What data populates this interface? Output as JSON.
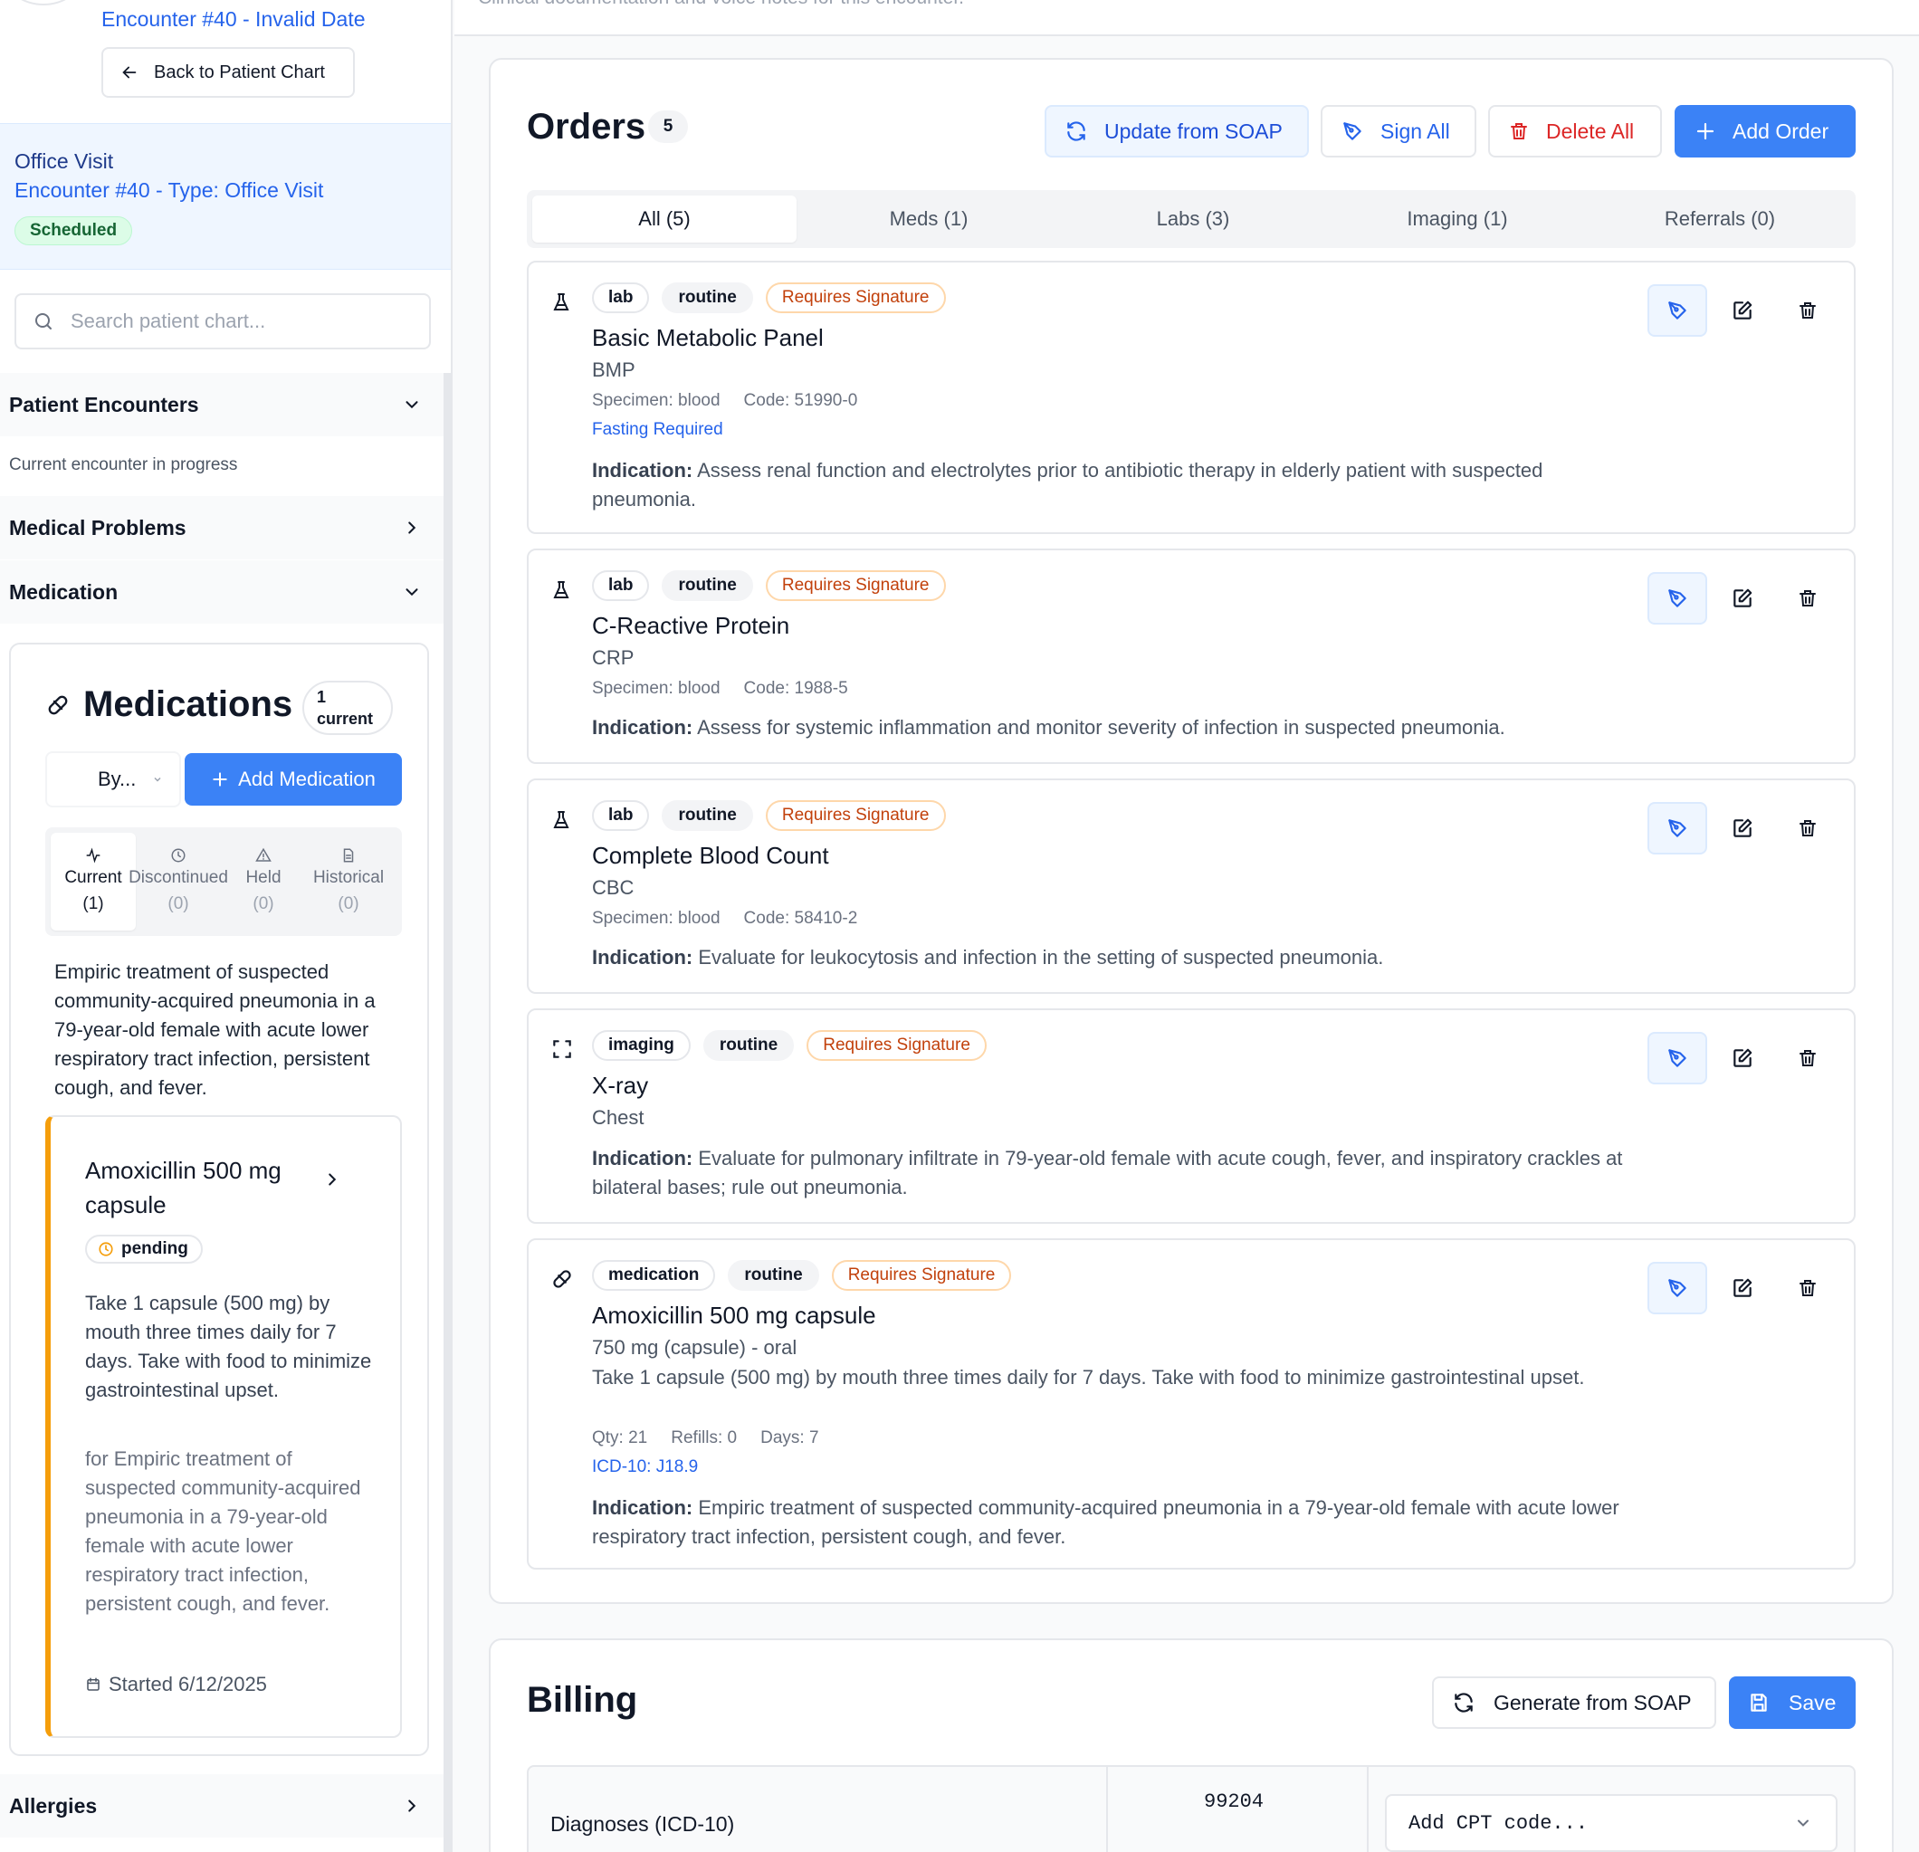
{
  "header": {
    "encounter_line": "Encounter #40 - Invalid Date",
    "back_button": "Back to Patient Chart",
    "subtitle": "Clinical documentation and voice notes for this encounter."
  },
  "visit": {
    "title": "Office Visit",
    "subtitle": "Encounter #40 - Type: Office Visit",
    "status": "Scheduled"
  },
  "search": {
    "placeholder": "Search patient chart..."
  },
  "sections": {
    "encounters": "Patient Encounters",
    "encounters_note": "Current encounter in progress",
    "problems": "Medical Problems",
    "medication": "Medication",
    "allergies": "Allergies"
  },
  "medications": {
    "title": "Medications",
    "count_num": "1",
    "count_label": "current",
    "sort_label": "By...",
    "add_button": "Add Medication",
    "tabs": [
      {
        "label": "Current",
        "count": "(1)",
        "icon": "activity-icon"
      },
      {
        "label": "Discontinued",
        "count": "(0)",
        "icon": "clock-icon"
      },
      {
        "label": "Held",
        "count": "(0)",
        "icon": "warning-icon"
      },
      {
        "label": "Historical",
        "count": "(0)",
        "icon": "document-icon"
      }
    ],
    "description": "Empiric treatment of suspected community-acquired pneumonia in a 79-year-old female with acute lower respiratory tract infection, persistent cough, and fever.",
    "item": {
      "name": "Amoxicillin 500 mg capsule",
      "status": "pending",
      "sig": "Take 1 capsule (500 mg) by mouth three times daily for 7 days. Take with food to minimize gastrointestinal upset.",
      "reason": "for Empiric treatment of suspected community-acquired pneumonia in a 79-year-old female with acute lower respiratory tract infection, persistent cough, and fever.",
      "started": "Started 6/12/2025",
      "accent_color": "#f59e0b"
    }
  },
  "orders": {
    "title": "Orders",
    "count": "5",
    "buttons": {
      "update": "Update from SOAP",
      "sign_all": "Sign All",
      "delete_all": "Delete All",
      "add": "Add Order"
    },
    "tabs": [
      "All (5)",
      "Meds (1)",
      "Labs (3)",
      "Imaging (1)",
      "Referrals (0)"
    ],
    "indication_label": "Indication:",
    "items": [
      {
        "type": "lab",
        "priority": "routine",
        "signature": "Requires Signature",
        "name": "Basic Metabolic Panel",
        "abbr": "BMP",
        "specimen": "Specimen: blood",
        "code": "Code: 51990-0",
        "note": "Fasting Required",
        "indication": "Assess renal function and electrolytes prior to antibiotic therapy in elderly patient with suspected pneumonia."
      },
      {
        "type": "lab",
        "priority": "routine",
        "signature": "Requires Signature",
        "name": "C-Reactive Protein",
        "abbr": "CRP",
        "specimen": "Specimen: blood",
        "code": "Code: 1988-5",
        "indication": "Assess for systemic inflammation and monitor severity of infection in suspected pneumonia."
      },
      {
        "type": "lab",
        "priority": "routine",
        "signature": "Requires Signature",
        "name": "Complete Blood Count",
        "abbr": "CBC",
        "specimen": "Specimen: blood",
        "code": "Code: 58410-2",
        "indication": "Evaluate for leukocytosis and infection in the setting of suspected pneumonia."
      },
      {
        "type": "imaging",
        "priority": "routine",
        "signature": "Requires Signature",
        "name": "X-ray",
        "abbr": "Chest",
        "indication": "Evaluate for pulmonary infiltrate in 79-year-old female with acute cough, fever, and inspiratory crackles at bilateral bases; rule out pneumonia."
      },
      {
        "type": "medication",
        "priority": "routine",
        "signature": "Requires Signature",
        "name": "Amoxicillin 500 mg capsule",
        "abbr": "750 mg (capsule) - oral",
        "sig": "Take 1 capsule (500 mg) by mouth three times daily for 7 days. Take with food to minimize gastrointestinal upset.",
        "qty": "Qty: 21",
        "refills": "Refills: 0",
        "days": "Days: 7",
        "icd": "ICD-10: J18.9",
        "indication": "Empiric treatment of suspected community-acquired pneumonia in a 79-year-old female with acute lower respiratory tract infection, persistent cough, and fever."
      }
    ]
  },
  "billing": {
    "title": "Billing",
    "generate": "Generate from SOAP",
    "save": "Save",
    "diagnoses_label": "Diagnoses (ICD-10)",
    "cpt_code": "99204",
    "add_cpt_placeholder": "Add CPT code..."
  },
  "colors": {
    "primary": "#3b82f6",
    "link": "#2563eb",
    "danger": "#dc2626",
    "warning_text": "#c2410c",
    "success_bg": "#dcfce7"
  }
}
